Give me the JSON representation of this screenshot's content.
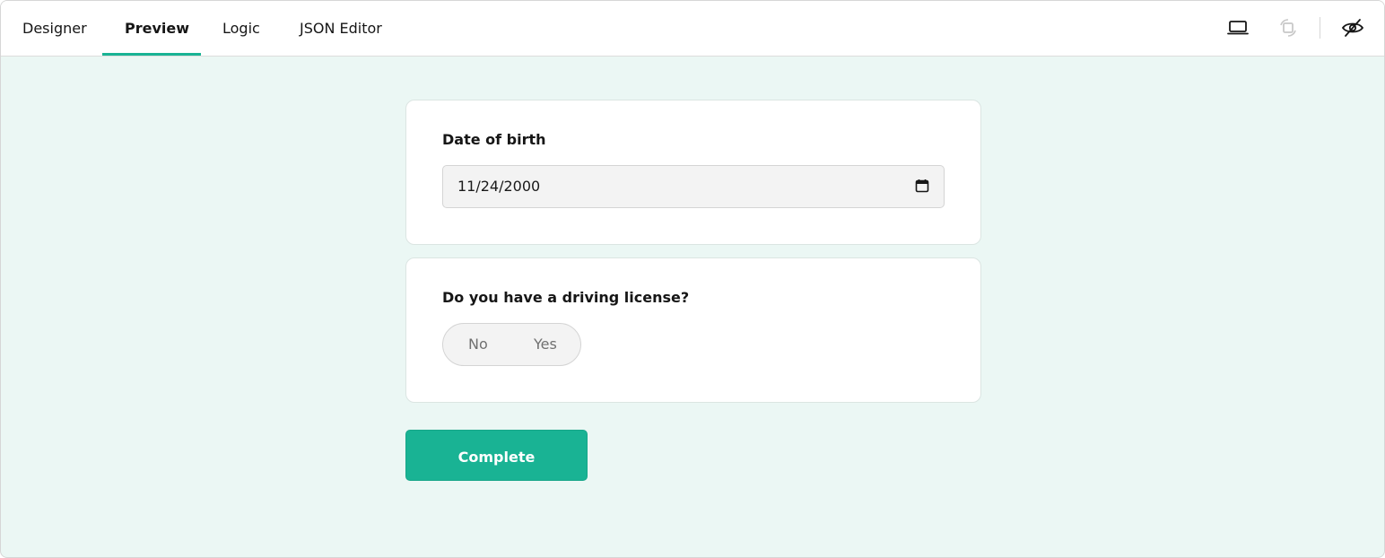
{
  "tabs": [
    {
      "label": "Designer",
      "active": false
    },
    {
      "label": "Preview",
      "active": true
    },
    {
      "label": "Logic",
      "active": false
    },
    {
      "label": "JSON Editor",
      "active": false
    }
  ],
  "toolbar": {
    "icons": [
      "laptop-icon",
      "rotate-device-icon",
      "eye-off-icon"
    ]
  },
  "questions": [
    {
      "title": "Date of birth",
      "type": "date",
      "value": "11/24/2000"
    },
    {
      "title": "Do you have a driving license?",
      "type": "boolean",
      "options": [
        "No",
        "Yes"
      ]
    }
  ],
  "complete_label": "Complete",
  "colors": {
    "accent": "#19b394",
    "background": "#ebf7f4",
    "card": "#ffffff"
  }
}
